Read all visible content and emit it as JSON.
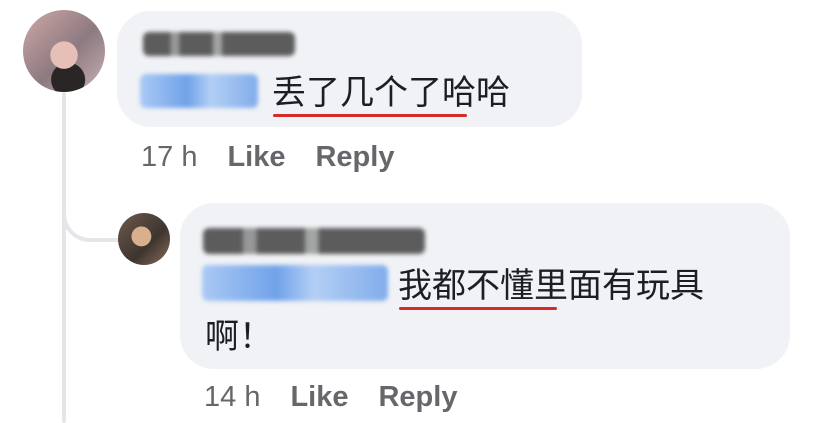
{
  "comments": [
    {
      "author": "Zhying Lee",
      "tag": "@ZLS",
      "text_line1": "丢了几个了哈哈",
      "text_line2": "",
      "time": "17 h",
      "like_label": "Like",
      "reply_label": "Reply"
    },
    {
      "author": "Mayi Tay LM",
      "tag": "Zhying Lee",
      "text_line1": "我都不懂里面有玩具",
      "text_line2": "啊！",
      "time": "14 h",
      "like_label": "Like",
      "reply_label": "Reply"
    }
  ],
  "colors": {
    "bubble_bg": "#f0f2f5",
    "meta_text": "#65676b",
    "underline": "#d42b2b",
    "thread_line": "#e4e6ea"
  }
}
